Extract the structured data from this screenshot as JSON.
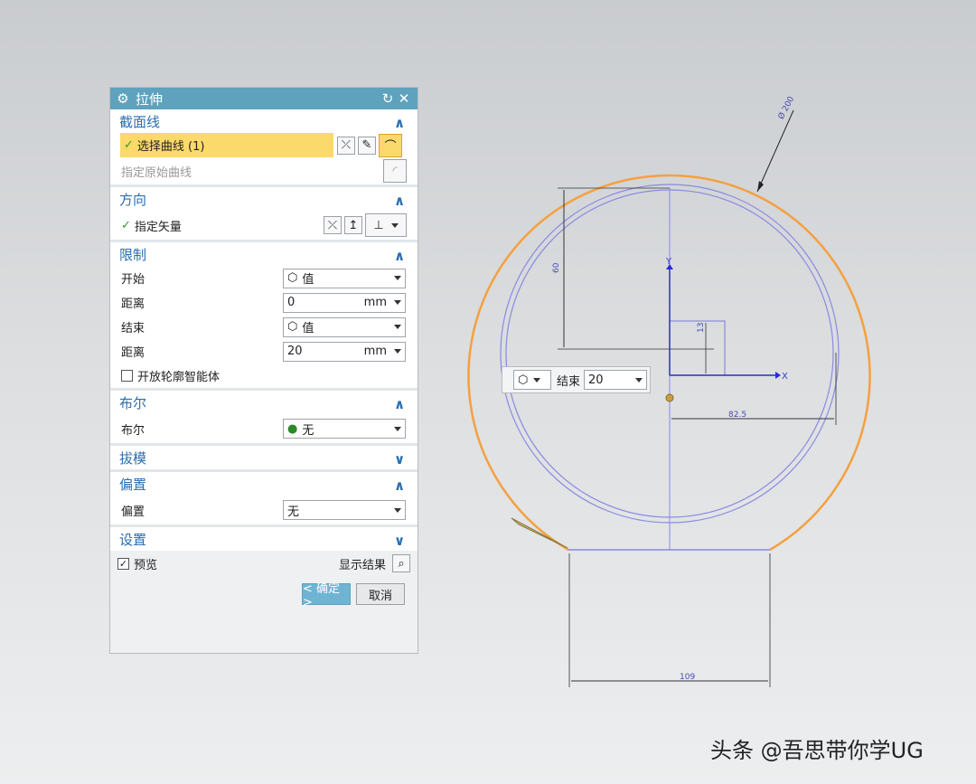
{
  "dialog": {
    "title": "拉伸",
    "sections": {
      "section_curve": {
        "label": "截面线",
        "select_curve": "选择曲线 (1)",
        "specify_curve": "指定原始曲线"
      },
      "direction": {
        "label": "方向",
        "specify_vector": "指定矢量"
      },
      "limits": {
        "label": "限制",
        "start_label": "开始",
        "start_value": "值",
        "start_distance_label": "距离",
        "start_distance": "0",
        "start_unit": "mm",
        "end_label": "结束",
        "end_value": "值",
        "end_distance_label": "距离",
        "end_distance": "20",
        "end_unit": "mm",
        "open_profile": "开放轮廓智能体"
      },
      "boolean": {
        "label": "布尔",
        "row_label": "布尔",
        "value": "无"
      },
      "draft": {
        "label": "拔模"
      },
      "offset": {
        "label": "偏置",
        "row_label": "偏置",
        "value": "无"
      },
      "settings": {
        "label": "设置"
      }
    },
    "preview": "预览",
    "show_result": "显示结果",
    "ok": "< 确定 >",
    "cancel": "取消"
  },
  "float_input": {
    "label": "结束",
    "value": "20"
  },
  "drawing": {
    "dim_diameter": "Ø 200",
    "dim_60": "60",
    "dim_13": "13",
    "dim_82_5": "82.5",
    "dim_109": "109",
    "axis_x": "X",
    "axis_y": "Y"
  },
  "watermark": "头条 @吾思带你学UG",
  "colors": {
    "accent": "#5ea2bd",
    "selected": "#fbd96b",
    "orange_curve": "#f5a040",
    "sketch_blue": "#8a8ae0"
  }
}
